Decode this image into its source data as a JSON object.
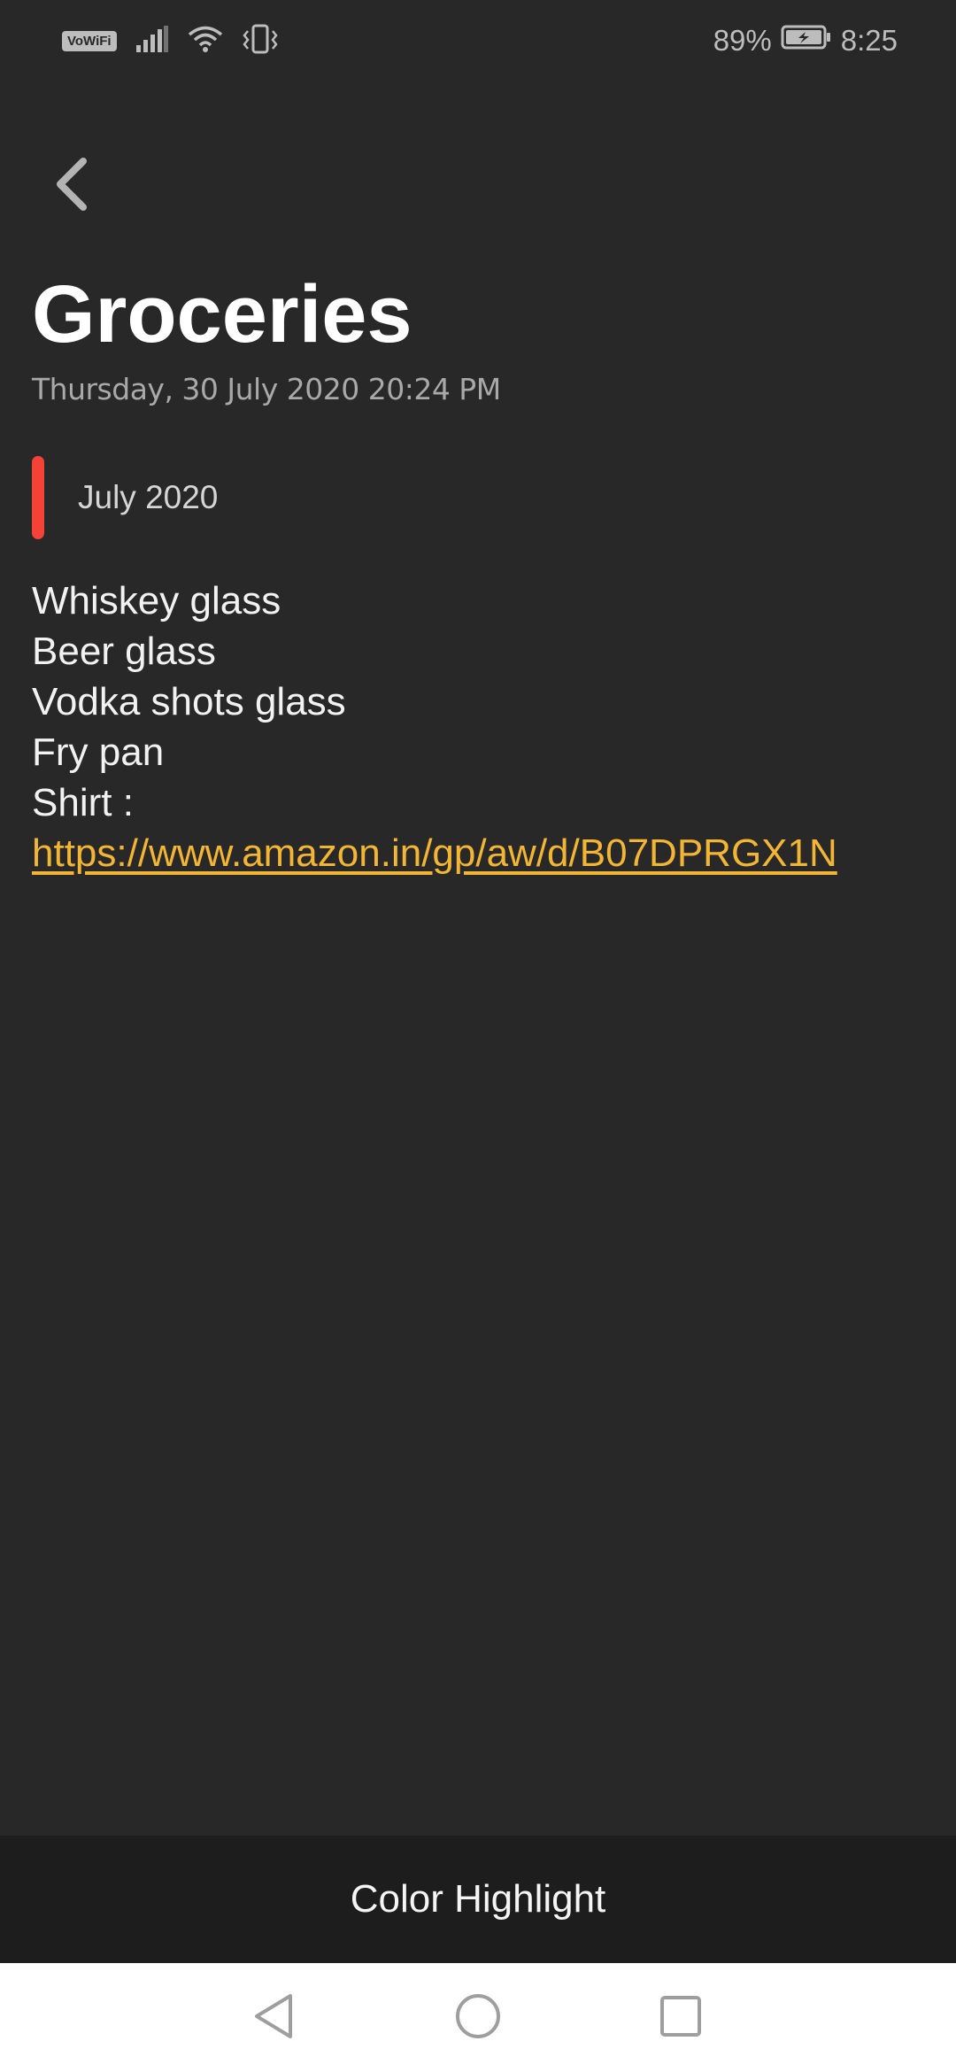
{
  "status_bar": {
    "vowifi_label": "VoWiFi",
    "battery_percent": "89%",
    "time": "8:25",
    "icons": [
      "signal-icon",
      "wifi-icon",
      "vibrate-icon",
      "battery-charging-icon"
    ]
  },
  "header": {
    "back_icon": "chevron-left-icon"
  },
  "note": {
    "title": "Groceries",
    "date": "Thursday, 30 July 2020 20:24 PM",
    "category": {
      "label": "July 2020",
      "color": "#f44336"
    },
    "lines": [
      "Whiskey glass",
      "Beer glass",
      "Vodka shots glass",
      "Fry pan",
      "Shirt :"
    ],
    "link": "https://www.amazon.in/gp/aw/d/B07DPRGX1N",
    "link_color": "#f2b534"
  },
  "bottom_action": {
    "label": "Color Highlight"
  },
  "nav_bar": {
    "icons": [
      "back-triangle-icon",
      "home-circle-icon",
      "recents-square-icon"
    ]
  }
}
